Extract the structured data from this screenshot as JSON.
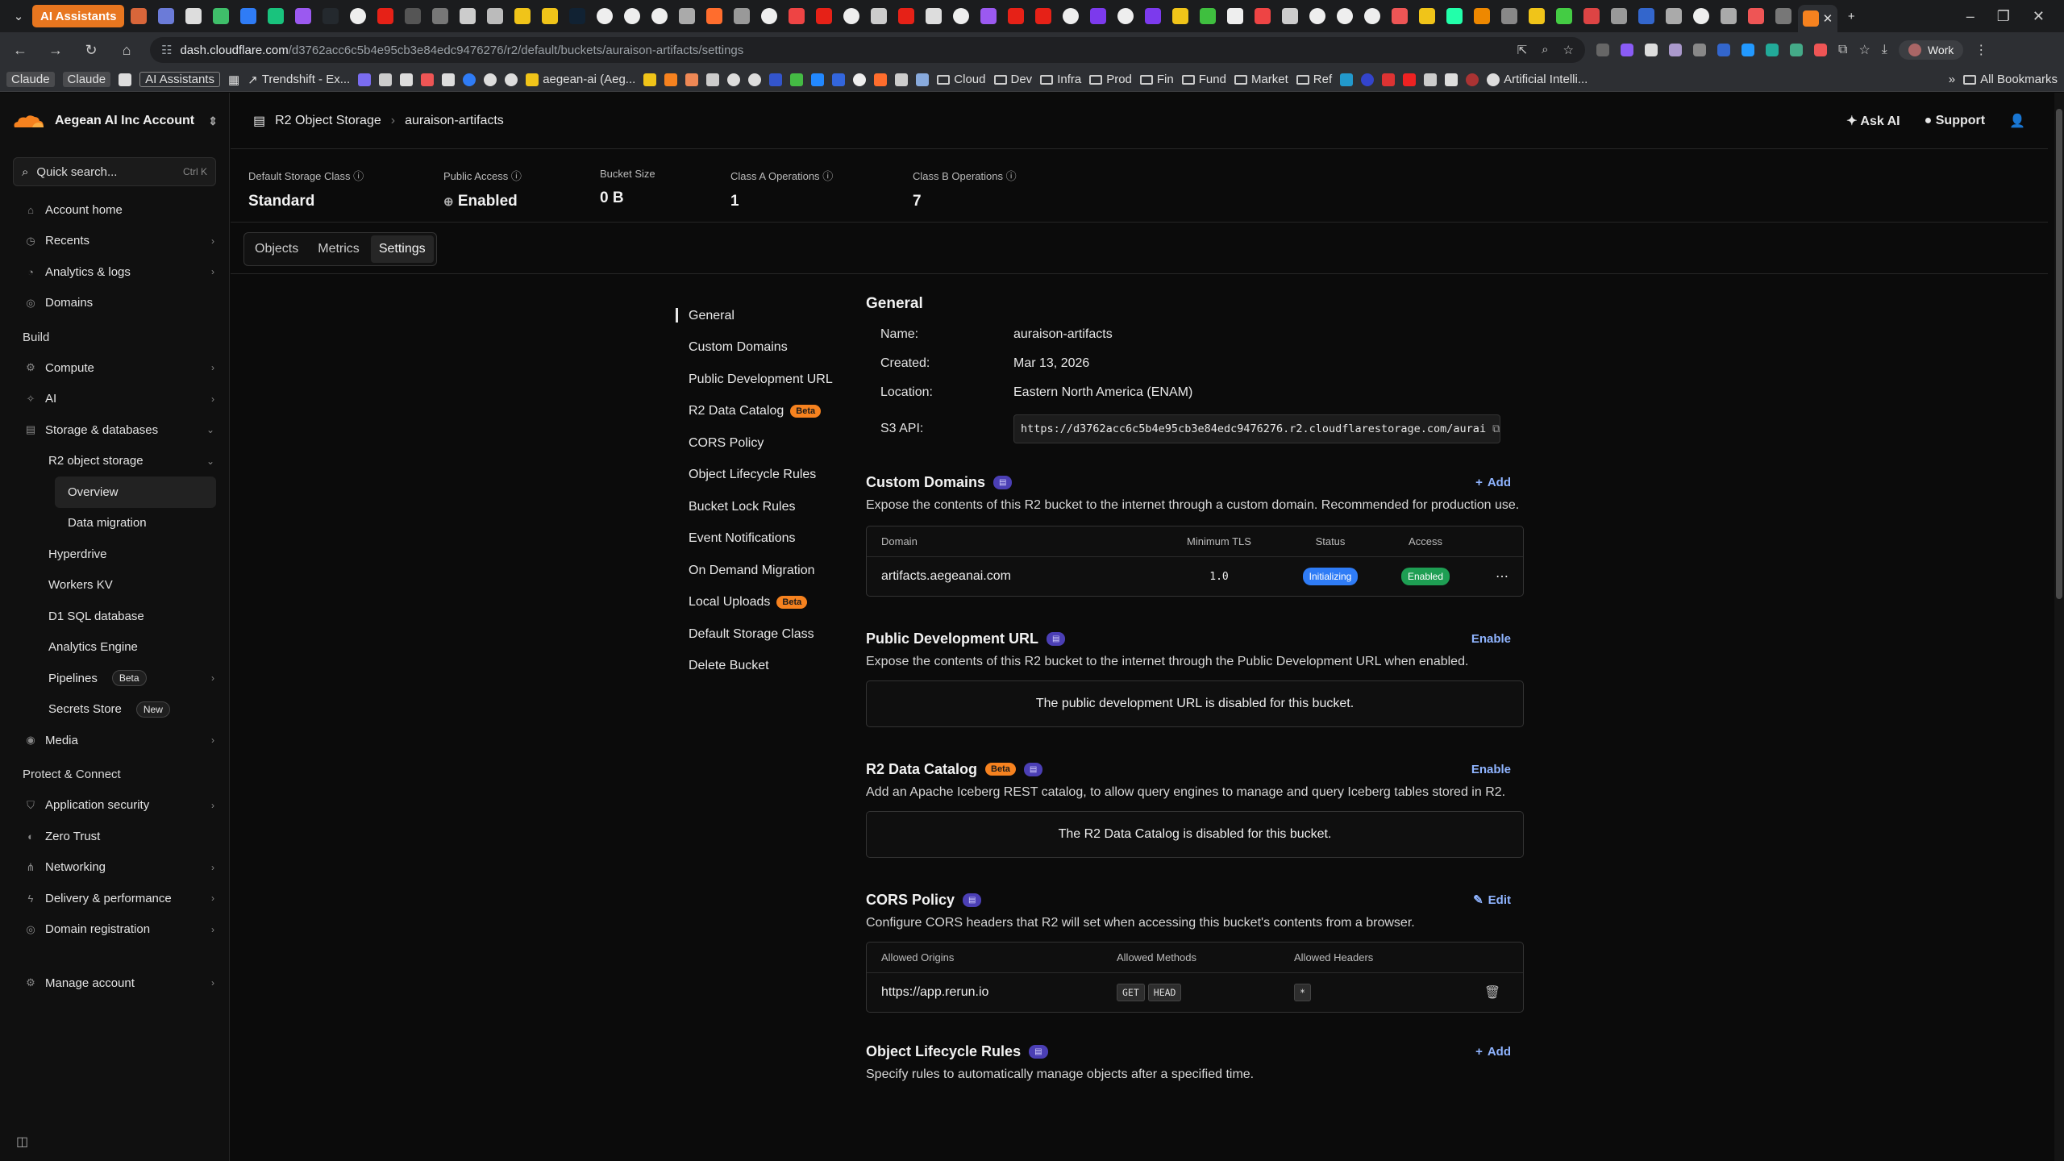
{
  "browser": {
    "tab_labels": [
      "AI Assistants"
    ],
    "url_host": "dash.cloudflare.com",
    "url_path": "/d3762acc6c5b4e95cb3e84edc9476276/r2/default/buckets/auraison-artifacts/settings",
    "profile": "Work"
  },
  "bookmarks": {
    "items": [
      "Claude",
      "Claude",
      "AI Assistants",
      "Trendshift - Ex...",
      "aegean-ai (Aeg...",
      "Cloud",
      "Dev",
      "Infra",
      "Prod",
      "Fin",
      "Fund",
      "Market",
      "Ref",
      "Artificial Intelli..."
    ],
    "all": "All Bookmarks"
  },
  "sidebar": {
    "account": "Aegean AI Inc Account",
    "search_placeholder": "Quick search...",
    "search_kbd": "Ctrl K",
    "top": [
      "Account home",
      "Recents",
      "Analytics & logs",
      "Domains"
    ],
    "build_label": "Build",
    "build": [
      "Compute",
      "AI",
      "Storage & databases"
    ],
    "r2": "R2 object storage",
    "r2_children": [
      "Overview",
      "Data migration"
    ],
    "storage_children": [
      "Hyperdrive",
      "Workers KV",
      "D1 SQL database",
      "Analytics Engine",
      "Pipelines",
      "Secrets Store"
    ],
    "pipelines_badge": "Beta",
    "secrets_badge": "New",
    "media": "Media",
    "protect_label": "Protect & Connect",
    "protect": [
      "Application security",
      "Zero Trust",
      "Networking",
      "Delivery & performance",
      "Domain registration"
    ],
    "manage": "Manage account"
  },
  "header": {
    "crumb1": "R2 Object Storage",
    "crumb2": "auraison-artifacts",
    "ask_ai": "Ask AI",
    "support": "Support"
  },
  "stats": [
    {
      "label": "Default Storage Class",
      "value": "Standard"
    },
    {
      "label": "Public Access",
      "value": "Enabled"
    },
    {
      "label": "Bucket Size",
      "value": "0 B"
    },
    {
      "label": "Class A Operations",
      "value": "1"
    },
    {
      "label": "Class B Operations",
      "value": "7"
    }
  ],
  "tabs": [
    "Objects",
    "Metrics",
    "Settings"
  ],
  "settings_nav": [
    "General",
    "Custom Domains",
    "Public Development URL",
    "R2 Data Catalog",
    "CORS Policy",
    "Object Lifecycle Rules",
    "Bucket Lock Rules",
    "Event Notifications",
    "On Demand Migration",
    "Local Uploads",
    "Default Storage Class",
    "Delete Bucket"
  ],
  "beta": "Beta",
  "general": {
    "title": "General",
    "name_k": "Name:",
    "name_v": "auraison-artifacts",
    "created_k": "Created:",
    "created_v": "Mar 13, 2026",
    "location_k": "Location:",
    "location_v": "Eastern North America (ENAM)",
    "s3_k": "S3 API:",
    "s3_v": "https://d3762acc6c5b4e95cb3e84edc9476276.r2.cloudflarestorage.com/aurai"
  },
  "custom_domains": {
    "title": "Custom Domains",
    "action": "Add",
    "desc": "Expose the contents of this R2 bucket to the internet through a custom domain. Recommended for production use.",
    "headers": [
      "Domain",
      "Minimum TLS",
      "Status",
      "Access"
    ],
    "row": {
      "domain": "artifacts.aegeanai.com",
      "tls": "1.0",
      "status": "Initializing",
      "access": "Enabled"
    }
  },
  "public_dev": {
    "title": "Public Development URL",
    "action": "Enable",
    "desc": "Expose the contents of this R2 bucket to the internet through the Public Development URL when enabled.",
    "empty": "The public development URL is disabled for this bucket."
  },
  "catalog": {
    "title": "R2 Data Catalog",
    "action": "Enable",
    "desc": "Add an Apache Iceberg REST catalog, to allow query engines to manage and query Iceberg tables stored in R2.",
    "empty": "The R2 Data Catalog is disabled for this bucket."
  },
  "cors": {
    "title": "CORS Policy",
    "action": "Edit",
    "desc": "Configure CORS headers that R2 will set when accessing this bucket's contents from a browser.",
    "headers": [
      "Allowed Origins",
      "Allowed Methods",
      "Allowed Headers"
    ],
    "row": {
      "origin": "https://app.rerun.io",
      "m1": "GET",
      "m2": "HEAD",
      "hdr": "*"
    }
  },
  "lifecycle": {
    "title": "Object Lifecycle Rules",
    "action": "Add",
    "desc": "Specify rules to automatically manage objects after a specified time."
  }
}
